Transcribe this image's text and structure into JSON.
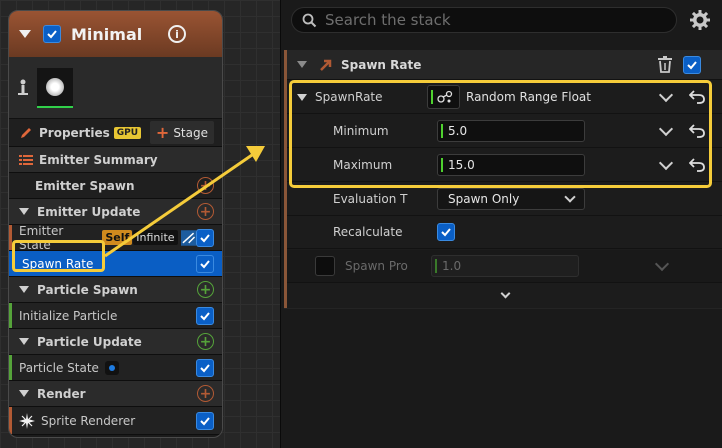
{
  "emitter": {
    "title": "Minimal",
    "properties_label": "Properties",
    "gpu_badge": "GPU",
    "stage_button": "Stage",
    "rows": [
      {
        "label": "Emitter Summary"
      },
      {
        "label": "Emitter Spawn"
      },
      {
        "label": "Emitter Update"
      },
      {
        "label": "Emitter State",
        "badge_self": "Self",
        "badge_infinite": "Infinite"
      },
      {
        "label": "Spawn Rate"
      },
      {
        "label": "Particle Spawn"
      },
      {
        "label": "Initialize Particle"
      },
      {
        "label": "Particle Update"
      },
      {
        "label": "Particle State"
      },
      {
        "label": "Render"
      },
      {
        "label": "Sprite Renderer"
      }
    ]
  },
  "search": {
    "placeholder": "Search the stack"
  },
  "stack": {
    "module_title": "Spawn Rate",
    "spawnrate_label": "SpawnRate",
    "spawnrate_value": "Random Range Float",
    "minimum_label": "Minimum",
    "minimum_value": "5.0",
    "maximum_label": "Maximum",
    "maximum_value": "15.0",
    "evaluation_label": "Evaluation T",
    "evaluation_value": "Spawn Only",
    "recalculate_label": "Recalculate",
    "spawn_pro_label": "Spawn Pro",
    "spawn_pro_value": "1.0"
  },
  "colors": {
    "accent_blue": "#0a5ec4",
    "highlight_yellow": "#f5cc3a",
    "module_orange": "#9a5433",
    "value_green": "#4fd12f"
  }
}
